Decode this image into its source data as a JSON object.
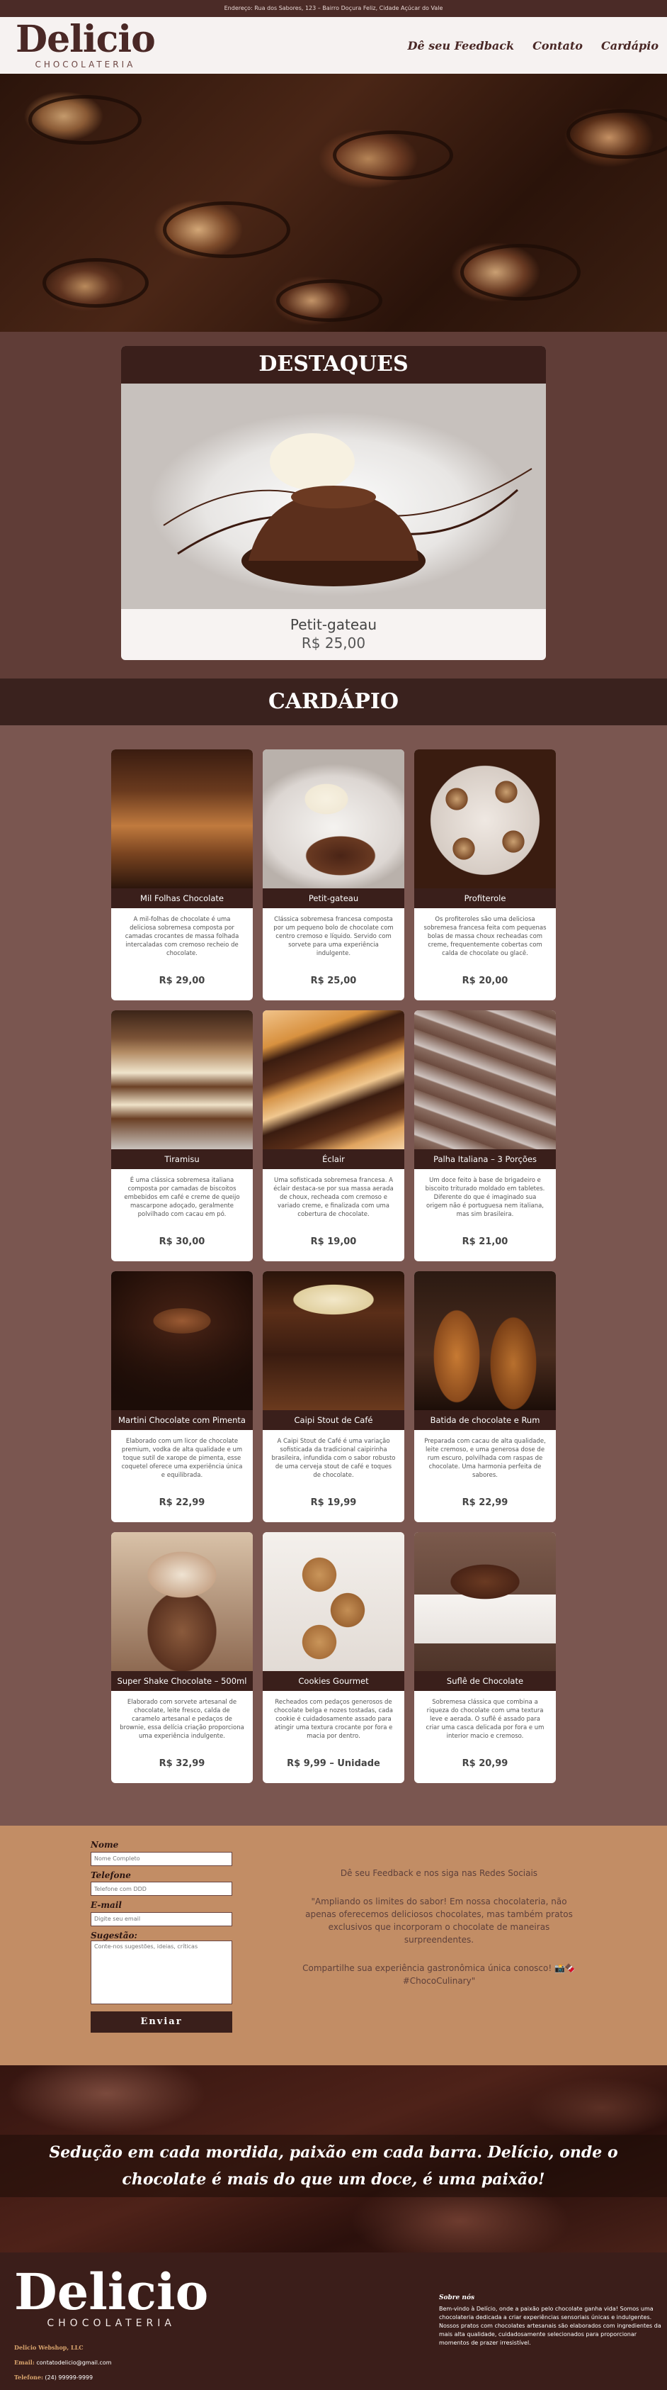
{
  "topbar": {
    "address": "Endereço: Rua dos Sabores, 123 – Bairro Doçura Feliz, Cidade Açúcar do Vale"
  },
  "header": {
    "logo_word": "Delicio",
    "logo_sub": "CHOCOLATERIA",
    "nav": [
      "Dê seu Feedback",
      "Contato",
      "Cardápio"
    ]
  },
  "destaques": {
    "title": "DESTAQUES",
    "item_name": "Petit-gateau",
    "item_price": "R$ 25,00"
  },
  "cardapio": {
    "title": "CARDÁPIO",
    "items": [
      {
        "name": "Mil Folhas Chocolate",
        "desc": "A mil-folhas de chocolate é uma deliciosa sobremesa composta por camadas crocantes de massa folhada intercaladas com cremoso recheio de chocolate.",
        "price": "R$ 29,00"
      },
      {
        "name": "Petit-gateau",
        "desc": "Clássica sobremesa francesa composta por um pequeno bolo de chocolate com centro cremoso e líquido. Servido com sorvete para uma experiência indulgente.",
        "price": "R$ 25,00"
      },
      {
        "name": "Profiterole",
        "desc": "Os profiteroles são uma deliciosa sobremesa francesa feita com pequenas bolas de massa choux recheadas com creme, frequentemente cobertas com calda de chocolate ou glacê.",
        "price": "R$ 20,00"
      },
      {
        "name": "Tiramisu",
        "desc": "É uma clássica sobremesa italiana composta por camadas de biscoitos embebidos em café e creme de queijo mascarpone adoçado, geralmente polvilhado com cacau em pó.",
        "price": "R$ 30,00"
      },
      {
        "name": "Éclair",
        "desc": "Uma sofisticada sobremesa francesa. A éclair destaca-se por sua massa aerada de choux, recheada com cremoso e variado creme, e finalizada com uma cobertura de chocolate.",
        "price": "R$ 19,00"
      },
      {
        "name": "Palha Italiana – 3 Porções",
        "desc": "Um doce feito à base de brigadeiro e biscoito triturado moldado em tabletes. Diferente do que é imaginado sua origem não é portuguesa nem italiana, mas sim brasileira.",
        "price": "R$ 21,00"
      },
      {
        "name": "Martini Chocolate com Pimenta",
        "desc": "Elaborado com um licor de chocolate premium, vodka de alta qualidade e um toque sutil de xarope de pimenta, esse coquetel oferece uma experiência única e equilibrada.",
        "price": "R$ 22,99"
      },
      {
        "name": "Caipi Stout de Café",
        "desc": "A Caipi Stout de Café é uma variação sofisticada da tradicional caipirinha brasileira, infundida com o sabor robusto de uma cerveja stout de café e toques de chocolate.",
        "price": "R$ 19,99"
      },
      {
        "name": "Batida de chocolate e Rum",
        "desc": "Preparada com cacau de alta qualidade, leite cremoso, e uma generosa dose de rum escuro, polvilhada com raspas de chocolate. Uma harmonia perfeita de sabores.",
        "price": "R$ 22,99"
      },
      {
        "name": "Super Shake Chocolate – 500ml",
        "desc": "Elaborado com sorvete artesanal de chocolate, leite fresco, calda de caramelo artesanal e pedaços de brownie, essa delícia criação proporciona uma experiência indulgente.",
        "price": "R$ 32,99"
      },
      {
        "name": "Cookies Gourmet",
        "desc": "Recheados com pedaços generosos de chocolate belga e nozes tostadas, cada cookie é cuidadosamente assado para atingir uma textura crocante por fora e macia por dentro.",
        "price": "R$ 9,99 – Unidade"
      },
      {
        "name": "Suflê de Chocolate",
        "desc": "Sobremesa clássica que combina a riqueza do chocolate com uma textura leve e aerada. O suflê é assado para criar uma casca delicada por fora e um interior macio e cremoso.",
        "price": "R$ 20,99"
      }
    ]
  },
  "form": {
    "name_label": "Nome",
    "name_placeholder": "Nome Completo",
    "phone_label": "Telefone",
    "phone_placeholder": "Telefone com DDD",
    "email_label": "E-mail",
    "email_placeholder": "Digite seu email",
    "sugg_label": "Sugestão:",
    "sugg_placeholder": "Conte-nos sugestões, ideias, críticas",
    "submit": "Enviar",
    "right_title": "Dê seu Feedback e nos siga nas Redes Sociais",
    "right_quote": "\"Ampliando os limites do sabor! Em nossa chocolateria, não apenas oferecemos deliciosos chocolates, mas também pratos exclusivos que incorporam o chocolate de maneiras surpreendentes.",
    "right_share": "Compartilhe sua experiência gastronômica única conosco! 📸🍫 #ChocoCulinary\""
  },
  "banner": {
    "text": "Sedução em cada mordida, paixão em cada barra. Delício, onde o chocolate é mais do que um doce, é uma paixão!"
  },
  "footer": {
    "logo_word": "Delicio",
    "logo_sub": "CHOCOLATERIA",
    "company": "Delicio Webshop, LLC",
    "email_key": "Email:",
    "email_val": " contatodelicio@gmail.com",
    "phone_key": "Telefone:",
    "phone_val": " (24) 99999-9999",
    "about_title": "Sobre nós",
    "about_text": "Bem-vindo à Delício, onde a paixão pelo chocolate ganha vida! Somos uma chocolateria dedicada a criar experiências sensoriais únicas e indulgentes. Nossos pratos com chocolates artesanais são elaborados com ingredientes da mais alta qualidade, cuidadosamente selecionados para proporcionar momentos de prazer irresistível."
  }
}
